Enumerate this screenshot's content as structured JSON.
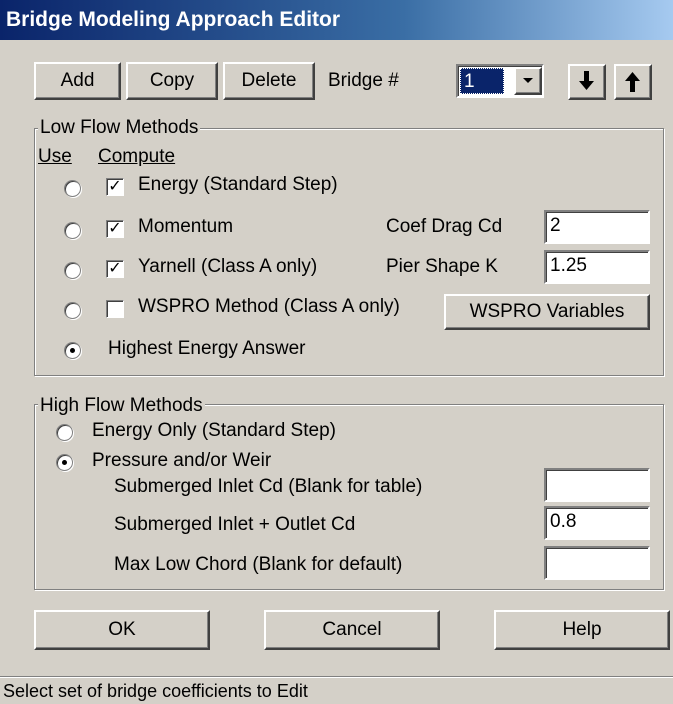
{
  "window": {
    "title": "Bridge Modeling Approach Editor"
  },
  "toolbar": {
    "add_label": "Add",
    "copy_label": "Copy",
    "delete_label": "Delete",
    "bridge_label": "Bridge #",
    "bridge_selected": "1",
    "down_icon": "arrow-down",
    "up_icon": "arrow-up"
  },
  "low_flow": {
    "legend": "Low Flow Methods",
    "use_header": "Use",
    "compute_header": "Compute",
    "methods": [
      {
        "label": "Energy (Standard Step)",
        "use": false,
        "compute": true
      },
      {
        "label": "Momentum",
        "use": false,
        "compute": true
      },
      {
        "label": "Yarnell (Class A only)",
        "use": false,
        "compute": true
      },
      {
        "label": "WSPRO Method (Class A only)",
        "use": false,
        "compute": false
      }
    ],
    "highest_energy_label": "Highest Energy Answer",
    "highest_energy_selected": true,
    "coef_drag_label": "Coef Drag Cd",
    "coef_drag_value": "2",
    "pier_shape_label": "Pier Shape K",
    "pier_shape_value": "1.25",
    "wspro_button_label": "WSPRO Variables"
  },
  "high_flow": {
    "legend": "High Flow Methods",
    "energy_only_label": "Energy Only (Standard Step)",
    "energy_only_selected": false,
    "pressure_weir_label": "Pressure and/or Weir",
    "pressure_weir_selected": true,
    "submerged_inlet_label": "Submerged Inlet Cd (Blank for table)",
    "submerged_inlet_value": "",
    "submerged_inlet_outlet_label": "Submerged Inlet + Outlet Cd",
    "submerged_inlet_outlet_value": "0.8",
    "max_low_chord_label": "Max Low Chord (Blank for default)",
    "max_low_chord_value": ""
  },
  "footer": {
    "ok_label": "OK",
    "cancel_label": "Cancel",
    "help_label": "Help"
  },
  "status": {
    "text": "Select set of bridge coefficients to Edit"
  },
  "colors": {
    "face": "#d4d0c8",
    "title_start": "#0a246a",
    "title_end": "#a6caf0",
    "selection": "#0a246a"
  }
}
